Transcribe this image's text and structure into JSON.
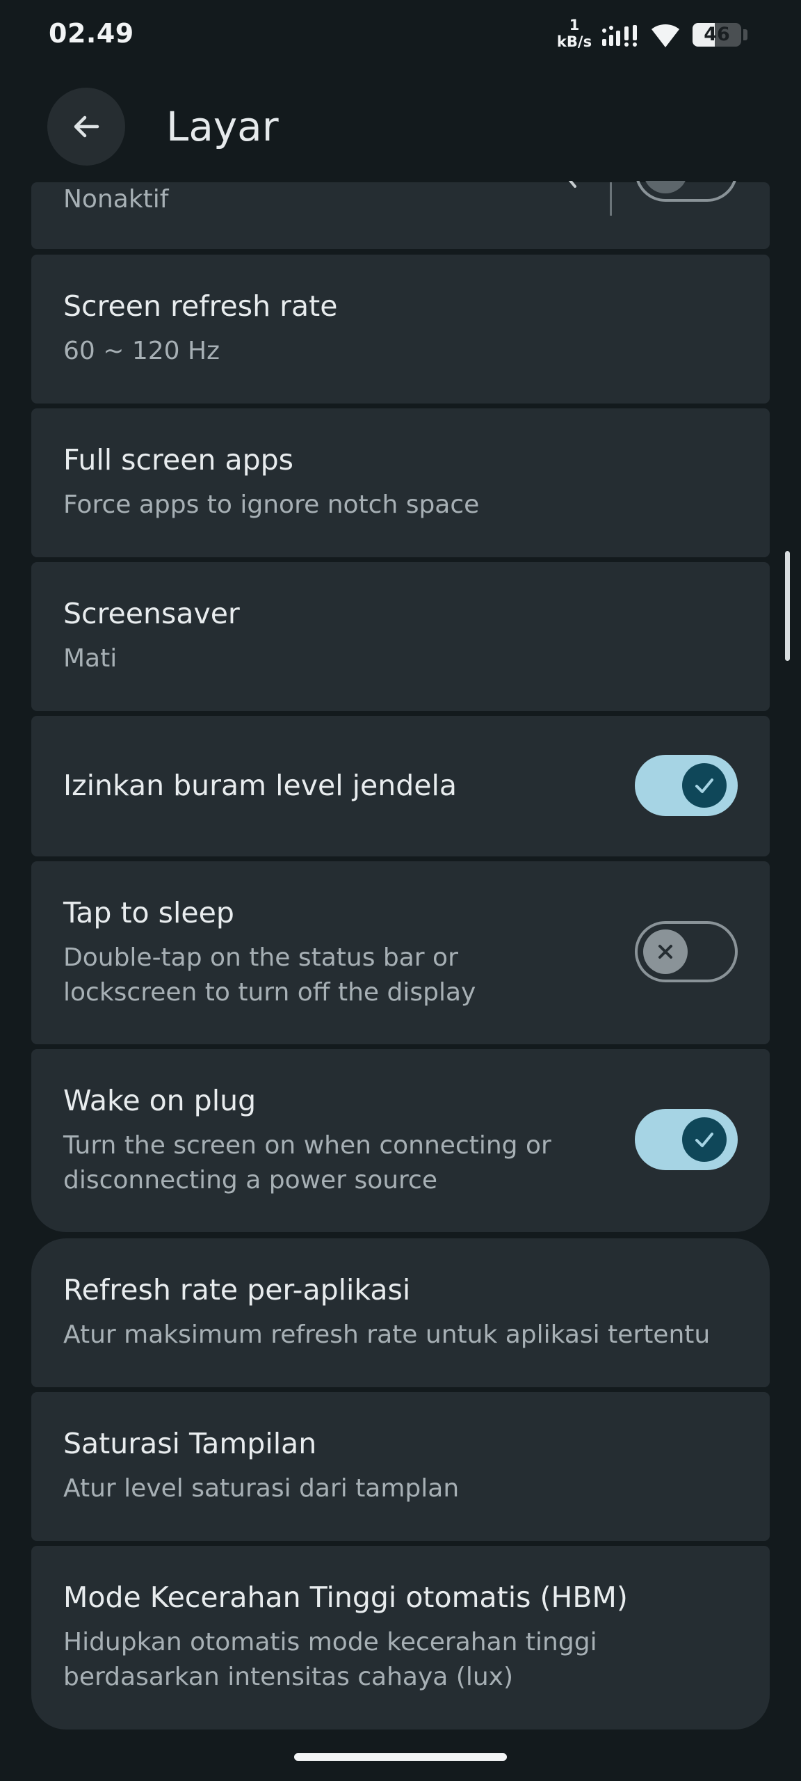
{
  "status_bar": {
    "time": "02.49",
    "net_speed_value": "1",
    "net_speed_unit": "kB/s",
    "battery_level": "46",
    "battery_fraction": 0.46
  },
  "app_bar": {
    "title": "Layar"
  },
  "settings": {
    "partial_item": {
      "subtitle": "Nonaktif"
    },
    "refresh_rate": {
      "title": "Screen refresh rate",
      "subtitle": "60 ~ 120 Hz"
    },
    "full_screen_apps": {
      "title": "Full screen apps",
      "subtitle": "Force apps to ignore notch space"
    },
    "screensaver": {
      "title": "Screensaver",
      "subtitle": "Mati"
    },
    "window_blur": {
      "title": "Izinkan buram level jendela",
      "enabled": true
    },
    "tap_to_sleep": {
      "title": "Tap to sleep",
      "subtitle_line1": "Double-tap on the status bar or",
      "subtitle_line2": "lockscreen to turn off the display",
      "enabled": false
    },
    "wake_on_plug": {
      "title": "Wake on plug",
      "subtitle_line1": "Turn the screen on when connecting or",
      "subtitle_line2": "disconnecting a power source",
      "enabled": true
    },
    "per_app_refresh": {
      "title": "Refresh rate per-aplikasi",
      "subtitle": "Atur maksimum refresh rate untuk aplikasi tertentu"
    },
    "saturation": {
      "title": "Saturasi Tampilan",
      "subtitle": "Atur level saturasi dari tamplan"
    },
    "hbm": {
      "title": "Mode Kecerahan Tinggi otomatis (HBM)",
      "subtitle_line1": "Hidupkan otomatis mode kecerahan tinggi",
      "subtitle_line2": "berdasarkan intensitas cahaya (lux)"
    }
  },
  "colors": {
    "background": "#131a1d",
    "card": "#252d32",
    "toggle_on_track": "#a6d4e4",
    "toggle_on_knob": "#0f4759",
    "toggle_off_outline": "#8a9398"
  }
}
